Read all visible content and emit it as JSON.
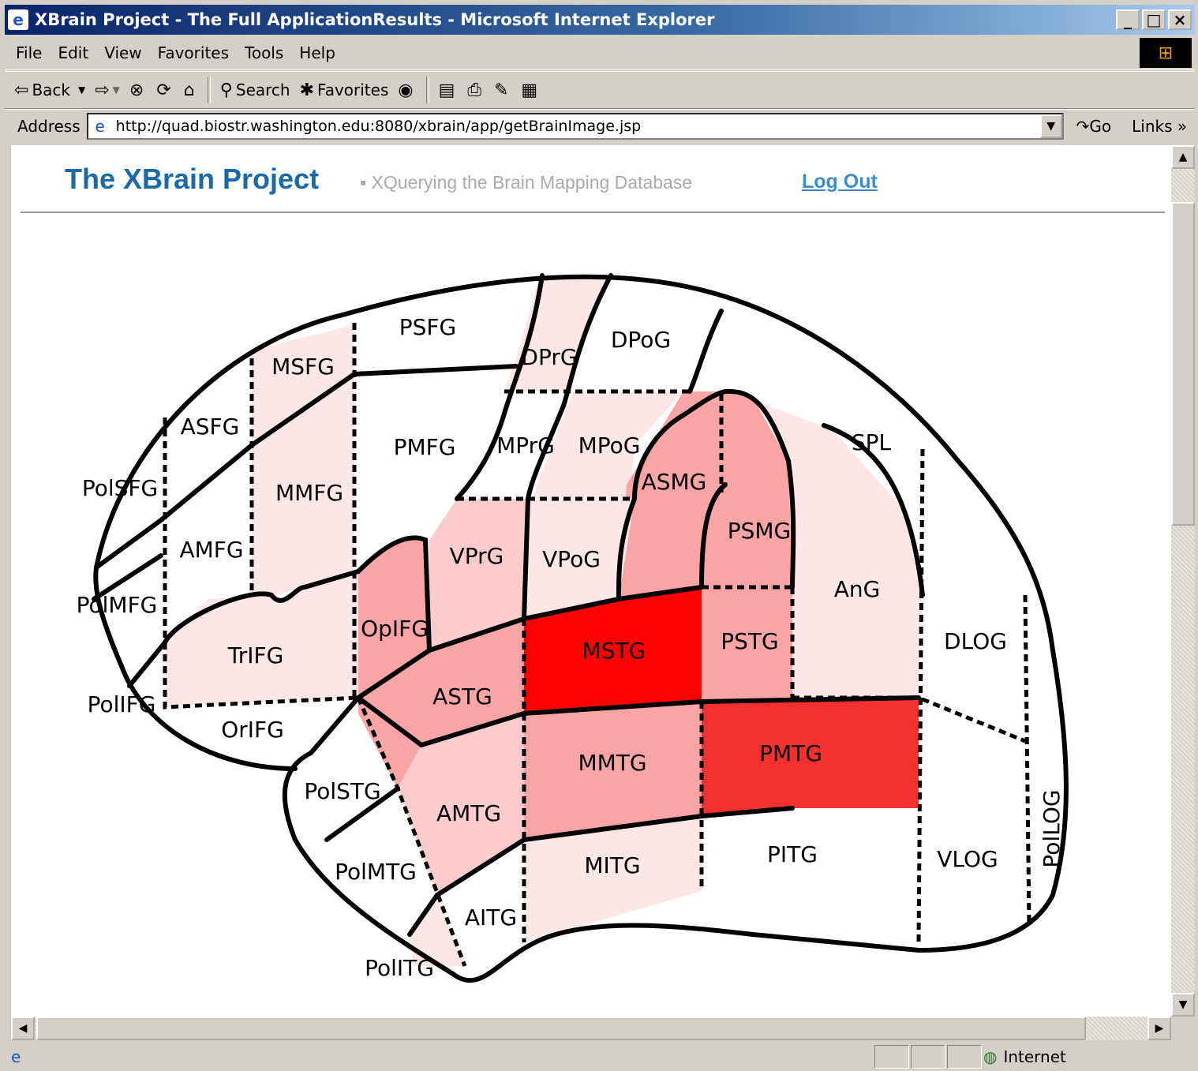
{
  "window": {
    "title": "XBrain Project - The Full ApplicationResults - Microsoft Internet Explorer",
    "icon": "ie-icon"
  },
  "menu": [
    "File",
    "Edit",
    "View",
    "Favorites",
    "Tools",
    "Help"
  ],
  "toolbar": {
    "back": "Back",
    "search": "Search",
    "favorites": "Favorites"
  },
  "address": {
    "label": "Address",
    "url": "http://quad.biostr.washington.edu:8080/xbrain/app/getBrainImage.jsp",
    "go": "Go",
    "links": "Links"
  },
  "page": {
    "title": "The XBrain Project",
    "subtitle": "▪ XQuerying the Brain Mapping Database",
    "logout": "Log Out"
  },
  "status": {
    "zone": "Internet"
  },
  "colors": {
    "white": "#ffffff",
    "very_light": "#fde6e6",
    "light": "#fccccc",
    "medium": "#f9a5a5",
    "strong": "#f33030",
    "red": "#ff0000"
  },
  "regions": [
    {
      "label": "PSFG",
      "intensity": "white"
    },
    {
      "label": "DPrG",
      "intensity": "very_light"
    },
    {
      "label": "DPoG",
      "intensity": "white"
    },
    {
      "label": "MSFG",
      "intensity": "very_light"
    },
    {
      "label": "ASFG",
      "intensity": "white"
    },
    {
      "label": "PolSFG",
      "intensity": "white"
    },
    {
      "label": "PMFG",
      "intensity": "white"
    },
    {
      "label": "MPrG",
      "intensity": "white"
    },
    {
      "label": "MPoG",
      "intensity": "very_light"
    },
    {
      "label": "ASMG",
      "intensity": "medium"
    },
    {
      "label": "SPL",
      "intensity": "white"
    },
    {
      "label": "MMFG",
      "intensity": "very_light"
    },
    {
      "label": "AMFG",
      "intensity": "white"
    },
    {
      "label": "PSMG",
      "intensity": "medium"
    },
    {
      "label": "VPrG",
      "intensity": "light"
    },
    {
      "label": "VPoG",
      "intensity": "very_light"
    },
    {
      "label": "PolMFG",
      "intensity": "white"
    },
    {
      "label": "AnG",
      "intensity": "very_light"
    },
    {
      "label": "OpIFG",
      "intensity": "medium"
    },
    {
      "label": "MSTG",
      "intensity": "red"
    },
    {
      "label": "PSTG",
      "intensity": "medium"
    },
    {
      "label": "TrIFG",
      "intensity": "very_light"
    },
    {
      "label": "DLOG",
      "intensity": "white"
    },
    {
      "label": "ASTG",
      "intensity": "medium"
    },
    {
      "label": "PolIFG",
      "intensity": "white"
    },
    {
      "label": "OrIFG",
      "intensity": "white"
    },
    {
      "label": "MMTG",
      "intensity": "medium"
    },
    {
      "label": "PMTG",
      "intensity": "strong"
    },
    {
      "label": "PolSTG",
      "intensity": "white"
    },
    {
      "label": "AMTG",
      "intensity": "light"
    },
    {
      "label": "PITG",
      "intensity": "white"
    },
    {
      "label": "VLOG",
      "intensity": "white"
    },
    {
      "label": "PolLOG",
      "intensity": "white"
    },
    {
      "label": "MITG",
      "intensity": "very_light"
    },
    {
      "label": "PolMTG",
      "intensity": "white"
    },
    {
      "label": "AITG",
      "intensity": "white"
    },
    {
      "label": "PolITG",
      "intensity": "very_light"
    }
  ]
}
